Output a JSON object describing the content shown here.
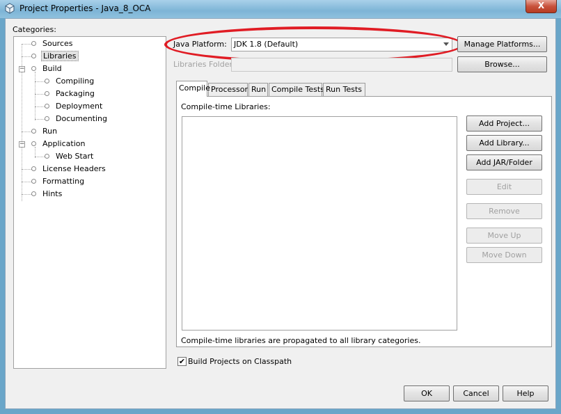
{
  "window": {
    "title": "Project Properties - Java_8_OCA",
    "close_glyph": "X"
  },
  "categories": {
    "label": "Categories:",
    "items": [
      {
        "label": "Sources"
      },
      {
        "label": "Libraries",
        "selected": true
      },
      {
        "label": "Build",
        "expanded": true
      },
      {
        "label": "Compiling"
      },
      {
        "label": "Packaging"
      },
      {
        "label": "Deployment"
      },
      {
        "label": "Documenting"
      },
      {
        "label": "Run"
      },
      {
        "label": "Application",
        "expanded": true
      },
      {
        "label": "Web Start"
      },
      {
        "label": "License Headers"
      },
      {
        "label": "Formatting"
      },
      {
        "label": "Hints"
      }
    ]
  },
  "platform": {
    "label": "Java Platform:",
    "value": "JDK 1.8 (Default)",
    "manage_button": "Manage Platforms..."
  },
  "libraries_folder": {
    "label": "Libraries Folder:",
    "value": "",
    "browse_button": "Browse..."
  },
  "tabs": [
    {
      "label": "Compile",
      "active": true
    },
    {
      "label": "Processor"
    },
    {
      "label": "Run"
    },
    {
      "label": "Compile Tests"
    },
    {
      "label": "Run Tests"
    }
  ],
  "compile": {
    "list_label": "Compile-time Libraries:",
    "note": "Compile-time libraries are propagated to all library categories.",
    "buttons": {
      "add_project": "Add Project...",
      "add_library": "Add Library...",
      "add_jar": "Add JAR/Folder",
      "edit": "Edit",
      "remove": "Remove",
      "move_up": "Move Up",
      "move_down": "Move Down"
    }
  },
  "build_on_classpath": {
    "label": "Build Projects on Classpath",
    "checked": true
  },
  "footer": {
    "ok": "OK",
    "cancel": "Cancel",
    "help": "Help"
  },
  "colors": {
    "highlight": "#e01c24",
    "title_bar": "#7db4d6",
    "dialog_bg": "#f0f0f0"
  }
}
